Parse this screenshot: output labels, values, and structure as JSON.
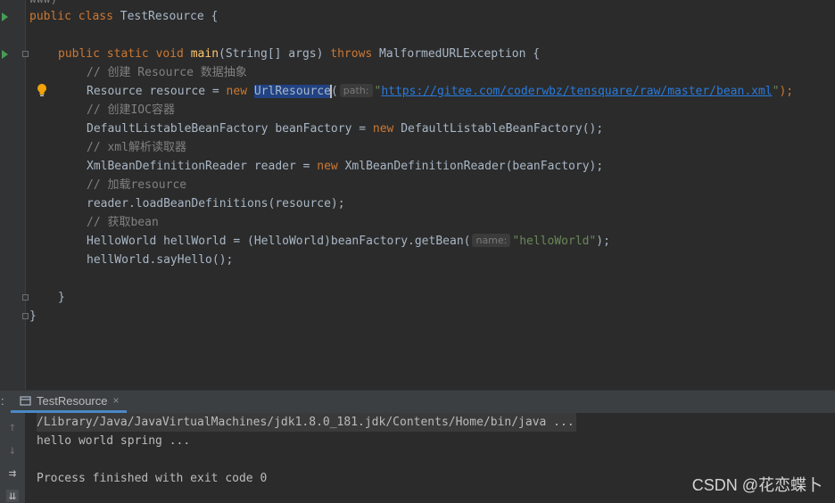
{
  "editor": {
    "top_fragment": "www)",
    "class_decl": {
      "kw": "public class",
      "name": " TestResource {"
    },
    "main_decl": {
      "kw1": "public static void",
      "fn": "main",
      "params": "(String[] args) ",
      "throws": "throws",
      "exc": " MalformedURLException {"
    },
    "c1": "// 创建 Resource 数据抽象",
    "l_resource": {
      "a": "Resource resource = ",
      "new": "new",
      "sp": " ",
      "cls": "UrlResource",
      "paren": "(",
      "hint": "path:",
      "q1": "\"",
      "url": "https://gitee.com/coderwbz/tensquare/raw/master/bean.xml",
      "q2": "\"",
      "end": ");"
    },
    "c2": "// 创建IOC容器",
    "l_factory": {
      "a": "DefaultListableBeanFactory beanFactory = ",
      "new": "new",
      "b": " DefaultListableBeanFactory();"
    },
    "c3": "// xml解析读取器",
    "l_reader": {
      "a": "XmlBeanDefinitionReader reader = ",
      "new": "new",
      "b": " XmlBeanDefinitionReader(beanFactory);"
    },
    "c4": "// 加载resource",
    "l_load": "reader.loadBeanDefinitions(resource);",
    "c5": "// 获取bean",
    "l_getbean": {
      "a": "HelloWorld hellWorld = (HelloWorld)beanFactory.getBean(",
      "hint": "name:",
      "str": "\"helloWorld\"",
      "end": ");"
    },
    "l_say": "hellWorld.sayHello();",
    "close_method": "}",
    "close_class": "}"
  },
  "bottom_panel": {
    "colon": ":",
    "tab_label": "TestResource",
    "tab_close": "×"
  },
  "console": {
    "lines": [
      "/Library/Java/JavaVirtualMachines/jdk1.8.0_181.jdk/Contents/Home/bin/java ...",
      "hello world spring ...",
      "Process finished with exit code 0"
    ]
  },
  "watermark": "CSDN @花恋蝶卜",
  "icons": [
    "run-arrow-icon",
    "fold-icon",
    "lightbulb-icon",
    "file-tab-icon",
    "arrow-up-icon",
    "arrow-down-icon",
    "soft-wrap-icon",
    "scroll-to-end-icon"
  ],
  "colors": {
    "keyword": "#cc7832",
    "function": "#ffc66d",
    "comment": "#808080",
    "string": "#6a8759",
    "url": "#287bde",
    "selection": "#214283",
    "run": "#499c54"
  }
}
